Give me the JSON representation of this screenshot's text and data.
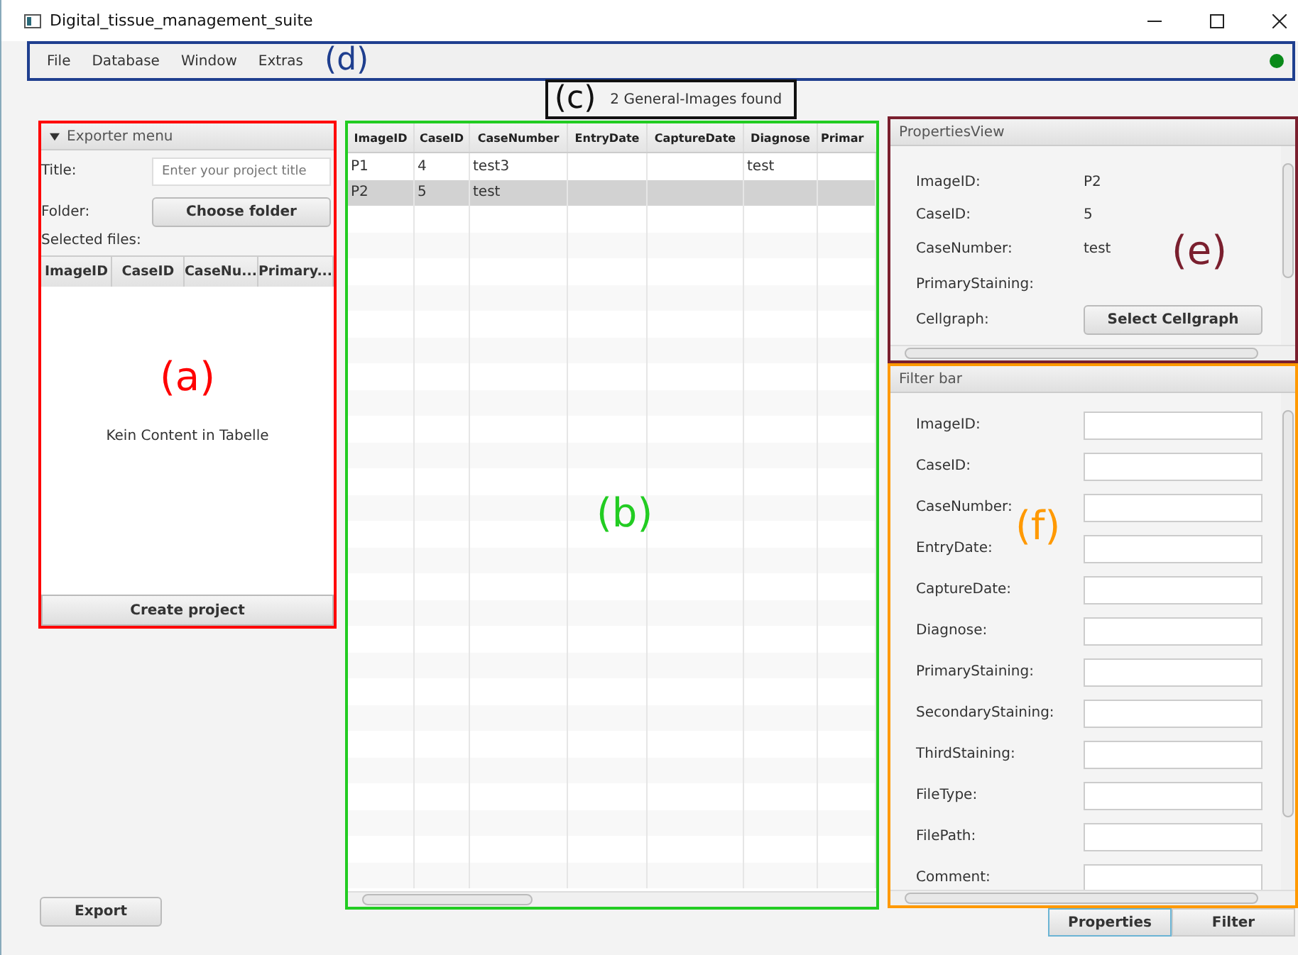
{
  "window": {
    "title": "Digital_tissue_management_suite"
  },
  "annotations": [
    {
      "label": "(a)",
      "color": "#ff0000"
    },
    {
      "label": "(b)",
      "color": "#22cc22"
    },
    {
      "label": "(c)",
      "color": "#111111"
    },
    {
      "label": "(d)",
      "color": "#1f3f8f"
    },
    {
      "label": "(e)",
      "color": "#7a1f2e"
    },
    {
      "label": "(f)",
      "color": "#ff9900"
    }
  ],
  "menu": [
    "File",
    "Database",
    "Window",
    "Extras"
  ],
  "status_dot": {
    "color": "#0a8a1a"
  },
  "result_text": "2 General-Images  found",
  "exporter": {
    "title": "Exporter menu",
    "expanded": true,
    "title_label": "Title:",
    "title_placeholder": "Enter your project title",
    "folder_label": "Folder:",
    "folder_button": "Choose folder",
    "files_label": "Selected files:",
    "columns": [
      "ImageID",
      "CaseID",
      "CaseNu...",
      "Primary..."
    ],
    "empty_text": "Kein Content in Tabelle",
    "create_button": "Create project"
  },
  "table": {
    "columns": [
      "ImageID",
      "CaseID",
      "CaseNumber",
      "EntryDate",
      "CaptureDate",
      "Diagnose",
      "Primar"
    ],
    "rows": [
      {
        "cells": [
          "P1",
          "4",
          "test3",
          "",
          "",
          "test",
          ""
        ],
        "selected": false
      },
      {
        "cells": [
          "P2",
          "5",
          "test",
          "",
          "",
          "",
          ""
        ],
        "selected": true
      }
    ]
  },
  "properties": {
    "title": "PropertiesView",
    "fields": [
      {
        "label": "ImageID:",
        "value": "P2"
      },
      {
        "label": "CaseID:",
        "value": "5"
      },
      {
        "label": "CaseNumber:",
        "value": "test"
      },
      {
        "label": "PrimaryStaining:"
      }
    ],
    "cellgraph_label": "Cellgraph:",
    "cellgraph_button": "Select Cellgraph"
  },
  "filter": {
    "title": "Filter bar",
    "fields": [
      "ImageID:",
      "CaseID:",
      "CaseNumber:",
      "EntryDate:",
      "CaptureDate:",
      "Diagnose:",
      "PrimaryStaining:",
      "SecondaryStaining:",
      "ThirdStaining:",
      "FileType:",
      "FilePath:",
      "Comment:"
    ]
  },
  "export_button": "Export",
  "tabs": [
    {
      "label": "Properties",
      "selected": true
    },
    {
      "label": "Filter",
      "selected": false
    }
  ]
}
